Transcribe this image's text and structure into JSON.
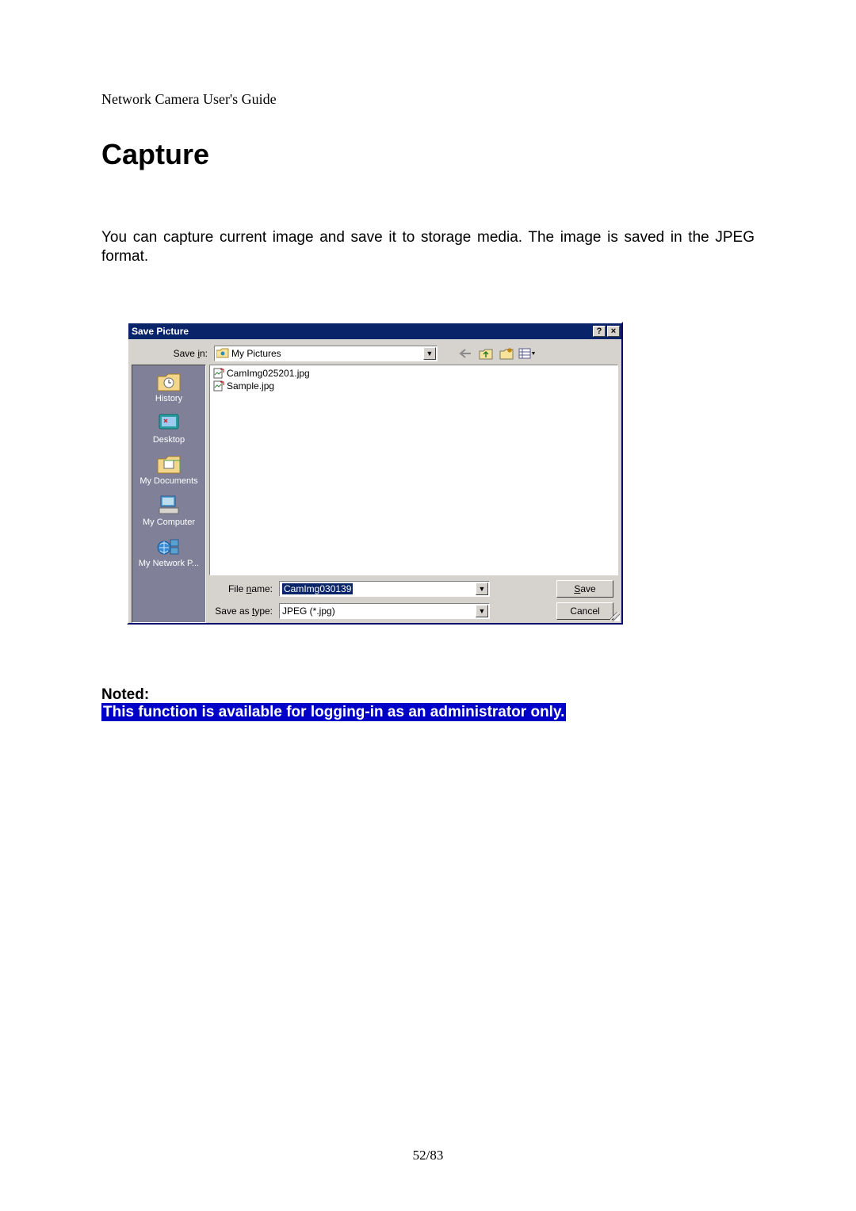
{
  "doc": {
    "header": "Network Camera User's Guide",
    "title": "Capture",
    "body": "You can capture current image and save it to storage media. The image is saved in the JPEG format.",
    "noted_label": "Noted:",
    "noted_text": "This function is available for logging-in as an administrator only.",
    "page_number": "52/83"
  },
  "dialog": {
    "title": "Save Picture",
    "help_btn": "?",
    "close_btn": "×",
    "save_in_label": "Save in:",
    "save_in_value": "My Pictures",
    "toolbar": {
      "back": "back-icon",
      "up": "up-one-level-icon",
      "newfolder": "new-folder-icon",
      "views": "views-icon"
    },
    "places": [
      {
        "label": "History"
      },
      {
        "label": "Desktop"
      },
      {
        "label": "My Documents"
      },
      {
        "label": "My Computer"
      },
      {
        "label": "My Network P..."
      }
    ],
    "files": [
      {
        "name": "CamImg025201.jpg"
      },
      {
        "name": "Sample.jpg"
      }
    ],
    "filename_label": "File name:",
    "filename_value": "CamImg030139",
    "type_label": "Save as type:",
    "type_value": "JPEG (*.jpg)",
    "save_btn": "Save",
    "cancel_btn": "Cancel"
  }
}
